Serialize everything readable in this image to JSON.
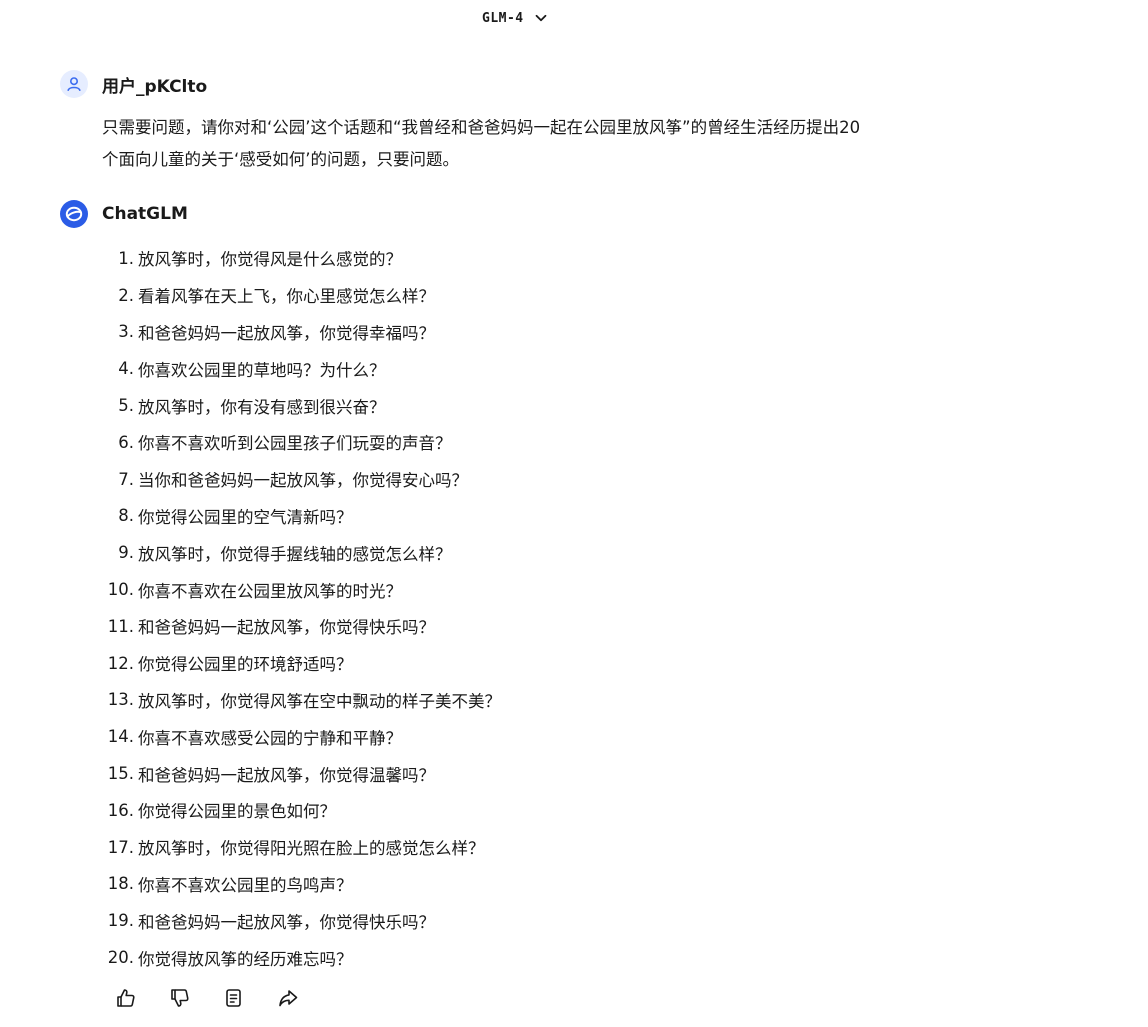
{
  "header": {
    "model_name": "GLM-4",
    "dropdown_icon": "chevron-down-icon"
  },
  "user_message": {
    "author": "用户_pKClto",
    "avatar_icon": "user-icon",
    "text_line1": "只需要问题，请你对和‘公园’这个话题和“我曾经和爸爸妈妈一起在公园里放风筝”的曾经生活经历提出20",
    "text_line2": "个面向儿童的关于‘感受如何’的问题，只要问题。"
  },
  "assistant_message": {
    "author": "ChatGLM",
    "avatar_icon": "chatglm-logo-icon",
    "items": [
      {
        "num": "1.",
        "text": "放风筝时，你觉得风是什么感觉的？"
      },
      {
        "num": "2.",
        "text": "看着风筝在天上飞，你心里感觉怎么样？"
      },
      {
        "num": "3.",
        "text": "和爸爸妈妈一起放风筝，你觉得幸福吗？"
      },
      {
        "num": "4.",
        "text": "你喜欢公园里的草地吗？为什么？"
      },
      {
        "num": "5.",
        "text": "放风筝时，你有没有感到很兴奋？"
      },
      {
        "num": "6.",
        "text": "你喜不喜欢听到公园里孩子们玩耍的声音？"
      },
      {
        "num": "7.",
        "text": "当你和爸爸妈妈一起放风筝，你觉得安心吗？"
      },
      {
        "num": "8.",
        "text": "你觉得公园里的空气清新吗？"
      },
      {
        "num": "9.",
        "text": "放风筝时，你觉得手握线轴的感觉怎么样？"
      },
      {
        "num": "10.",
        "text": "你喜不喜欢在公园里放风筝的时光？"
      },
      {
        "num": "11.",
        "text": "和爸爸妈妈一起放风筝，你觉得快乐吗？"
      },
      {
        "num": "12.",
        "text": "你觉得公园里的环境舒适吗？"
      },
      {
        "num": "13.",
        "text": "放风筝时，你觉得风筝在空中飘动的样子美不美？"
      },
      {
        "num": "14.",
        "text": "你喜不喜欢感受公园的宁静和平静？"
      },
      {
        "num": "15.",
        "text": "和爸爸妈妈一起放风筝，你觉得温馨吗？"
      },
      {
        "num": "16.",
        "text": "你觉得公园里的景色如何？"
      },
      {
        "num": "17.",
        "text": "放风筝时，你觉得阳光照在脸上的感觉怎么样？"
      },
      {
        "num": "18.",
        "text": "你喜不喜欢公园里的鸟鸣声？"
      },
      {
        "num": "19.",
        "text": "和爸爸妈妈一起放风筝，你觉得快乐吗？"
      },
      {
        "num": "20.",
        "text": "你觉得放风筝的经历难忘吗？"
      }
    ],
    "actions": [
      "thumbs-up-icon",
      "thumbs-down-icon",
      "copy-icon",
      "share-icon"
    ]
  },
  "colors": {
    "text": "#1a1a1a",
    "accent": "#2b5ce6",
    "user_avatar_bg": "#e6edff"
  }
}
